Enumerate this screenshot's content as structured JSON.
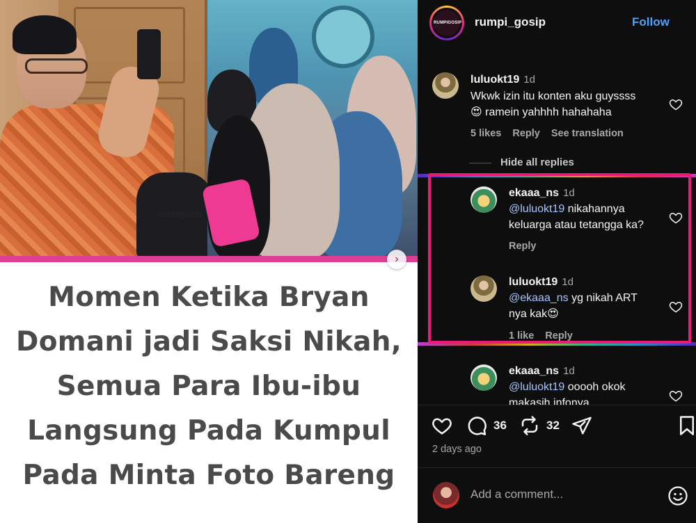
{
  "post": {
    "photo_watermark": "rumpigosip",
    "headline_lines": [
      "Momen Ketika Bryan",
      "Domani jadi Saksi Nikah,",
      "Semua Para Ibu-ibu",
      "Langsung Pada Kumpul",
      "Pada Minta Foto Bareng"
    ],
    "next_icon": "chevron-right-icon",
    "accent_color": "#dc3f94"
  },
  "header": {
    "avatar_text": "RUMPIGOSIP",
    "username": "rumpi_gosip",
    "follow_label": "Follow"
  },
  "comments": [
    {
      "username": "luluokt19",
      "time": "1d",
      "text_lines": [
        "Wkwk izin itu konten aku guyssss",
        "😍 ramein yahhhh hahahaha"
      ],
      "likes": "5 likes",
      "reply": "Reply",
      "translate": "See translation"
    }
  ],
  "hide_replies_label": "Hide all replies",
  "replies": [
    {
      "username": "ekaaa_ns",
      "time": "1d",
      "mention": "@luluokt19",
      "text_rest": " nikahannya",
      "text_line2": "keluarga atau tetangga ka?",
      "reply": "Reply"
    },
    {
      "username": "luluokt19",
      "time": "1d",
      "mention": "@ekaaa_ns",
      "text_rest": " yg nikah ART",
      "text_line2": "nya kak😍",
      "likes": "1 like",
      "reply": "Reply"
    },
    {
      "username": "ekaaa_ns",
      "time": "1d",
      "mention": "@luluokt19",
      "text_rest": " ooooh okok",
      "text_line2": "makasih infonya"
    }
  ],
  "actions": {
    "comment_count": "36",
    "repost_count": "32",
    "time_ago": "2 days ago"
  },
  "add_comment": {
    "placeholder": "Add a comment..."
  },
  "colors": {
    "background_dark": "#0e0e0e",
    "link_blue": "#4aa3ff",
    "mention_blue": "#a7c4ff",
    "highlight_border": "#e81b77"
  }
}
